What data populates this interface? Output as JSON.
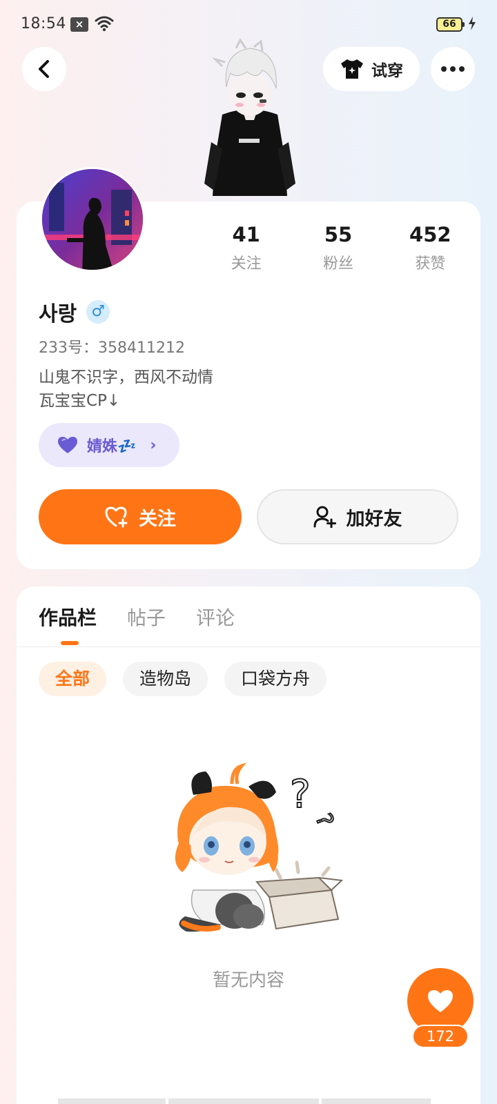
{
  "status_bar": {
    "time": "18:54",
    "battery": "66"
  },
  "header": {
    "try_on_label": "试穿"
  },
  "profile": {
    "username": "사랑",
    "gender_symbol": "♂",
    "uid": "233号：358411212",
    "bio_line1": "山鬼不识字，西风不动情",
    "bio_line2": "瓦宝宝CP↓",
    "status_label": "婧姝💤",
    "stats": [
      {
        "num": "41",
        "label": "关注"
      },
      {
        "num": "55",
        "label": "粉丝"
      },
      {
        "num": "452",
        "label": "获赞"
      }
    ],
    "follow_label": "关注",
    "add_friend_label": "加好友"
  },
  "content": {
    "tabs": [
      "作品栏",
      "帖子",
      "评论"
    ],
    "filters": [
      "全部",
      "造物岛",
      "口袋方舟"
    ],
    "empty_text": "暂无内容"
  },
  "like": {
    "count": "172"
  },
  "colors": {
    "accent": "#ff7516",
    "status_chip_bg": "#ebe8fb",
    "gender_blue": "#2f8fd8"
  },
  "icons": [
    "back-icon",
    "shirt-icon",
    "more-icon",
    "wifi-icon",
    "heart-plus-icon",
    "add-user-icon",
    "heart-icon",
    "chevron-right-icon"
  ]
}
